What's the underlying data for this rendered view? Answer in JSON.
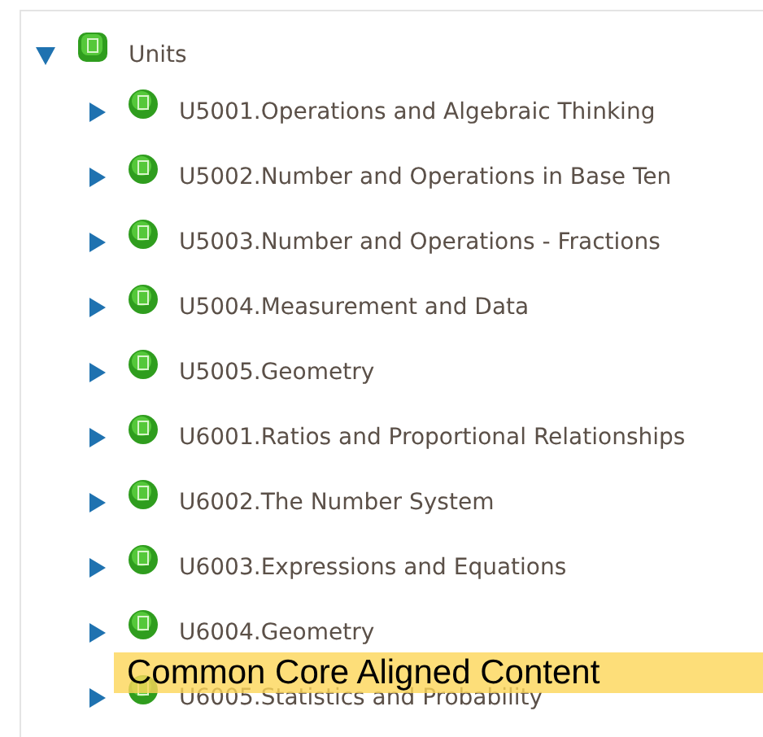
{
  "tree": [
    {
      "label": "Units",
      "expanded": true,
      "children": [
        {
          "label": "U5001.Operations and Algebraic Thinking",
          "expanded": false
        },
        {
          "label": "U5002.Number and Operations in Base Ten",
          "expanded": false
        },
        {
          "label": "U5003.Number and Operations - Fractions",
          "expanded": false
        },
        {
          "label": "U5004.Measurement and Data",
          "expanded": false
        },
        {
          "label": "U5005.Geometry",
          "expanded": false
        },
        {
          "label": "U6001.Ratios and Proportional Relationships",
          "expanded": false
        },
        {
          "label": "U6002.The Number System",
          "expanded": false
        },
        {
          "label": "U6003.Expressions and Equations",
          "expanded": false
        },
        {
          "label": "U6004.Geometry",
          "expanded": false
        },
        {
          "label": "U6005.Statistics and Probability",
          "expanded": false
        }
      ]
    }
  ],
  "banner": {
    "text": "Common Core Aligned Content"
  }
}
